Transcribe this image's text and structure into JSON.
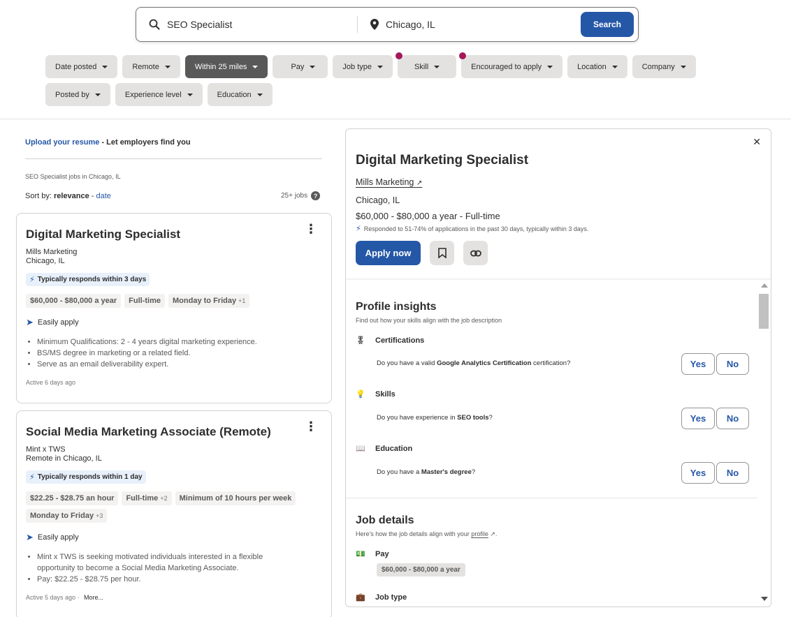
{
  "search": {
    "what_value": "SEO Specialist",
    "where_value": "Chicago, IL",
    "button_label": "Search"
  },
  "filters": {
    "row1": [
      {
        "label": "Date posted",
        "active": false,
        "dot": false
      },
      {
        "label": "Remote",
        "active": false,
        "dot": false
      },
      {
        "label": "Within 25 miles",
        "active": true,
        "dot": false
      },
      {
        "label": "Pay",
        "active": false,
        "dot": false
      },
      {
        "label": "Job type",
        "active": false,
        "dot": false
      },
      {
        "label": "Skill",
        "active": false,
        "dot": true
      },
      {
        "label": "Encouraged to apply",
        "active": false,
        "dot": true
      },
      {
        "label": "Location",
        "active": false,
        "dot": false
      },
      {
        "label": "Company",
        "active": false,
        "dot": false
      }
    ],
    "row2": [
      {
        "label": "Posted by",
        "active": false,
        "dot": false
      },
      {
        "label": "Experience level",
        "active": false,
        "dot": false
      },
      {
        "label": "Education",
        "active": false,
        "dot": false
      }
    ],
    "dot_color": "#a4185a"
  },
  "results": {
    "upload_link": "Upload your resume",
    "upload_rest": " - Let employers find you",
    "breadcrumb": "SEO Specialist jobs in Chicago, IL",
    "sort_prefix": "Sort by: ",
    "sort_active": "relevance",
    "sort_sep": " - ",
    "sort_other": "date",
    "count": "25+ jobs"
  },
  "jobs": [
    {
      "title": "Digital Marketing Specialist",
      "company": "Mills Marketing",
      "location": "Chicago, IL",
      "responds": "Typically responds within 3 days",
      "tags": [
        {
          "text": "$60,000 - $80,000 a year",
          "extra": ""
        },
        {
          "text": "Full-time",
          "extra": ""
        },
        {
          "text": "Monday to Friday",
          "extra": "+1"
        }
      ],
      "easy_apply": "Easily apply",
      "bullets": [
        "Minimum Qualifications: 2 - 4 years digital marketing experience.",
        "BS/MS degree in marketing or a related field.",
        "Serve as an email deliverability expert."
      ],
      "active": "Active 6 days ago",
      "more": ""
    },
    {
      "title": "Social Media Marketing Associate (Remote)",
      "company": "Mint x TWS",
      "location": "Remote in Chicago, IL",
      "responds": "Typically responds within 1 day",
      "tags": [
        {
          "text": "$22.25 - $28.75 an hour",
          "extra": ""
        },
        {
          "text": "Full-time",
          "extra": "+2"
        },
        {
          "text": "Minimum of 10 hours per week",
          "extra": ""
        },
        {
          "text": "Monday to Friday",
          "extra": "+3"
        }
      ],
      "easy_apply": "Easily apply",
      "bullets": [
        "Mint x TWS is seeking motivated individuals interested in a flexible opportunity to become a Social Media Marketing Associate.",
        "Pay: $22.25 - $28.75 per hour."
      ],
      "active": "Active 5 days ago",
      "more": "More..."
    }
  ],
  "detail": {
    "title": "Digital Marketing Specialist",
    "company": "Mills Marketing",
    "location": "Chicago, IL",
    "salary": "$60,000 - $80,000 a year",
    "job_type": "  - Full-time",
    "responded": "Responded to 51-74% of applications in the past 30 days, typically within 3 days.",
    "apply_label": "Apply now",
    "insights": {
      "heading": "Profile insights",
      "subtitle": "Find out how your skills align with the job description",
      "items": [
        {
          "label": "Certifications",
          "q_pre": "Do you have a valid ",
          "q_bold": "Google Analytics Certification",
          "q_post": " certification?"
        },
        {
          "label": "Skills",
          "q_pre": "Do you have experience in ",
          "q_bold": "SEO tools",
          "q_post": "?"
        },
        {
          "label": "Education",
          "q_pre": "Do you have a ",
          "q_bold": "Master's degree",
          "q_post": "?"
        }
      ],
      "yes_label": "Yes",
      "no_label": "No"
    },
    "job_details": {
      "heading": "Job details",
      "subtitle_pre": "Here's how the job details align with your ",
      "subtitle_link": "profile",
      "subtitle_post": ".",
      "pay_label": "Pay",
      "pay_value": "$60,000 - $80,000 a year",
      "job_type_label": "Job type"
    }
  },
  "colors": {
    "primary": "#2557a7",
    "text": "#2d2d2d",
    "chip": "#e4e2e0",
    "chip_active": "#595959"
  }
}
